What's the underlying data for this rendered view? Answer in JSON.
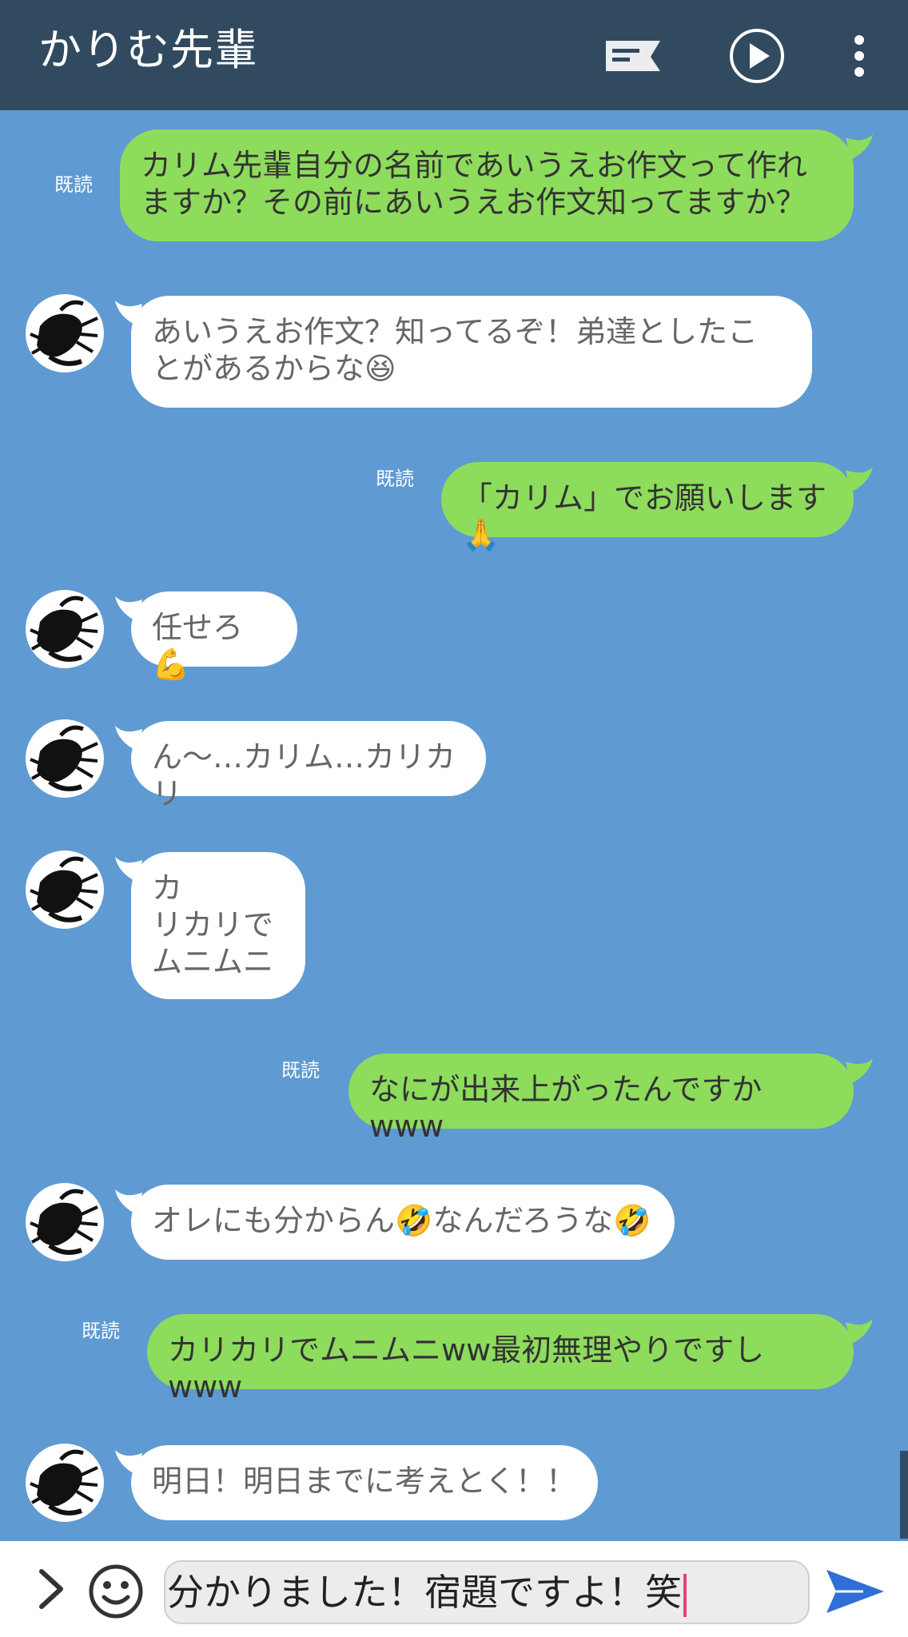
{
  "header": {
    "title": "かりむ先輩",
    "icons": [
      "notes-icon",
      "play-icon",
      "more-vert-icon"
    ]
  },
  "read_label": "既読",
  "messages": [
    {
      "side": "me",
      "text": "カリム先輩自分の名前であいうえお作文って作れ\nますか？その前にあいうえお作文知ってますか？",
      "read": "既読"
    },
    {
      "side": "them",
      "text": "あいうえお作文？知ってるぞ！弟達としたこ\nとがあるからな😆"
    },
    {
      "side": "me",
      "text": "「カリム」でお願いします🙏",
      "read": "既読"
    },
    {
      "side": "them",
      "text": "任せろ💪"
    },
    {
      "side": "them",
      "text": "ん〜…カリム…カリカリ"
    },
    {
      "side": "them",
      "text": "カ\nリカリで\nムニムニ"
    },
    {
      "side": "me",
      "text": "なにが出来上がったんですかwww",
      "read": "既読"
    },
    {
      "side": "them",
      "text": "オレにも分からん🤣なんだろうな🤣"
    },
    {
      "side": "me",
      "text": "カリカリでムニムニww最初無理やりですしwww",
      "read": "既読"
    },
    {
      "side": "them",
      "text": "明日！明日までに考えとく！！"
    }
  ],
  "input": {
    "value": "分かりました！宿題ですよ！笑"
  },
  "colors": {
    "background": "#5f9ad3",
    "header": "#324a5f",
    "my_bubble": "#8edc5c",
    "their_bubble": "#ffffff"
  }
}
